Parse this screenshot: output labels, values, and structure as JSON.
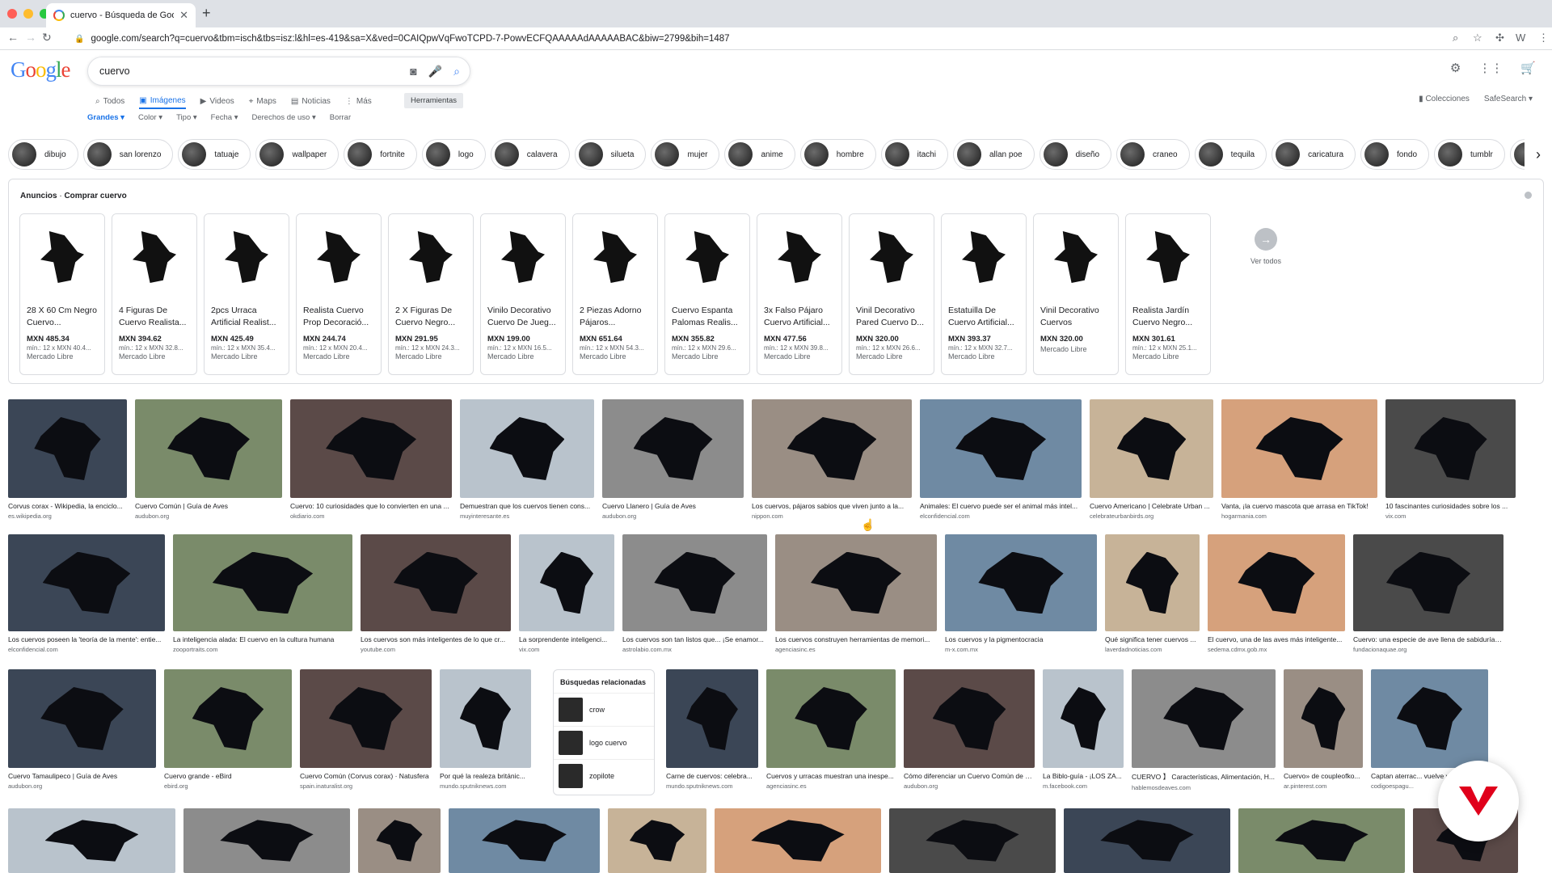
{
  "browser": {
    "tab_title": "cuervo - Búsqueda de Google",
    "url": "google.com/search?q=cuervo&tbm=isch&tbs=isz:l&hl=es-419&sa=X&ved=0CAIQpwVqFwoTCPD-7-PowvECFQAAAAAdAAAAABAC&biw=2799&bih=1487"
  },
  "search": {
    "query": "cuervo"
  },
  "nav_tabs": [
    "Todos",
    "Imágenes",
    "Videos",
    "Maps",
    "Noticias",
    "Más"
  ],
  "tools_label": "Herramientas",
  "right_links": [
    "Colecciones",
    "SafeSearch"
  ],
  "filters": [
    "Grandes",
    "Color",
    "Tipo",
    "Fecha",
    "Derechos de uso",
    "Borrar"
  ],
  "chips": [
    "dibujo",
    "san lorenzo",
    "tatuaje",
    "wallpaper",
    "fortnite",
    "logo",
    "calavera",
    "silueta",
    "mujer",
    "anime",
    "hombre",
    "itachi",
    "allan poe",
    "diseño",
    "craneo",
    "tequila",
    "caricatura",
    "fondo",
    "tumblr",
    "di"
  ],
  "ads": {
    "label": "Anuncios",
    "title": "Comprar cuervo",
    "see_all": "Ver todos",
    "cards": [
      {
        "title": "28 X 60 Cm Negro Cuervo...",
        "price": "MXN 485.34",
        "sub": "mín.: 12 x MXN 40.4...",
        "store": "Mercado Libre"
      },
      {
        "title": "4 Figuras De Cuervo Realista...",
        "price": "MXN 394.62",
        "sub": "mín.: 12 x MXN 32.8...",
        "store": "Mercado Libre"
      },
      {
        "title": "2pcs Urraca Artificial Realist...",
        "price": "MXN 425.49",
        "sub": "mín.: 12 x MXN 35.4...",
        "store": "Mercado Libre"
      },
      {
        "title": "Realista Cuervo Prop Decoració...",
        "price": "MXN 244.74",
        "sub": "mín.: 12 x MXN 20.4...",
        "store": "Mercado Libre"
      },
      {
        "title": "2 X Figuras De Cuervo Negro...",
        "price": "MXN 291.95",
        "sub": "mín.: 12 x MXN 24.3...",
        "store": "Mercado Libre"
      },
      {
        "title": "Vinilo Decorativo Cuervo De Jueg...",
        "price": "MXN 199.00",
        "sub": "mín.: 12 x MXN 16.5...",
        "store": "Mercado Libre"
      },
      {
        "title": "2 Piezas Adorno Pájaros...",
        "price": "MXN 651.64",
        "sub": "mín.: 12 x MXN 54.3...",
        "store": "Mercado Libre"
      },
      {
        "title": "Cuervo Espanta Palomas Realis...",
        "price": "MXN 355.82",
        "sub": "mín.: 12 x MXN 29.6...",
        "store": "Mercado Libre"
      },
      {
        "title": "3x Falso Pájaro Cuervo Artificial...",
        "price": "MXN 477.56",
        "sub": "mín.: 12 x MXN 39.8...",
        "store": "Mercado Libre"
      },
      {
        "title": "Vinil Decorativo Pared Cuervo D...",
        "price": "MXN 320.00",
        "sub": "mín.: 12 x MXN 26.6...",
        "store": "Mercado Libre"
      },
      {
        "title": "Estatuilla De Cuervo Artificial...",
        "price": "MXN 393.37",
        "sub": "mín.: 12 x MXN 32.7...",
        "store": "Mercado Libre"
      },
      {
        "title": "Vinil Decorativo Cuervos",
        "price": "MXN 320.00",
        "sub": "",
        "store": "Mercado Libre"
      },
      {
        "title": "Realista Jardín Cuervo Negro...",
        "price": "MXN 301.61",
        "sub": "mín.: 12 x MXN 25.1...",
        "store": "Mercado Libre"
      }
    ]
  },
  "results_row1": [
    {
      "title": "Corvus corax - Wikipedia, la enciclo...",
      "source": "es.wikipedia.org"
    },
    {
      "title": "Cuervo Común | Guía de Aves",
      "source": "audubon.org"
    },
    {
      "title": "Cuervo: 10 curiosidades que lo convierten en una ...",
      "source": "okdiario.com"
    },
    {
      "title": "Demuestran que los cuervos tienen cons...",
      "source": "muyinteresante.es"
    },
    {
      "title": "Cuervo Llanero | Guía de Aves",
      "source": "audubon.org"
    },
    {
      "title": "Los cuervos, pájaros sabios que viven junto a la...",
      "source": "nippon.com"
    },
    {
      "title": "Animales: El cuervo puede ser el animal más intel...",
      "source": "elconfidencial.com"
    },
    {
      "title": "Cuervo Americano | Celebrate Urban ...",
      "source": "celebrateurbanbirds.org"
    },
    {
      "title": "Vanta, ¡la cuervo mascota que arrasa en TikTok!",
      "source": "hogarmania.com"
    },
    {
      "title": "10 fascinantes curiosidades sobre los ...",
      "source": "vix.com"
    }
  ],
  "results_row2": [
    {
      "title": "Los cuervos poseen la 'teoría de la mente': entie...",
      "source": "elconfidencial.com"
    },
    {
      "title": "La inteligencia alada: El cuervo en la cultura humana",
      "source": "zooportraits.com"
    },
    {
      "title": "Los cuervos son más inteligentes de lo que cr...",
      "source": "youtube.com"
    },
    {
      "title": "La sorprendente inteligenci...",
      "source": "vix.com"
    },
    {
      "title": "Los cuervos son tan listos que... ¡Se enamor...",
      "source": "astrolabio.com.mx"
    },
    {
      "title": "Los cuervos construyen herramientas de memori...",
      "source": "agenciasinc.es"
    },
    {
      "title": "Los cuervos y la pigmentocracia",
      "source": "m-x.com.mx"
    },
    {
      "title": "Qué significa tener cuervos ...",
      "source": "laverdadnoticias.com"
    },
    {
      "title": "El cuervo, una de las aves más inteligente...",
      "source": "sedema.cdmx.gob.mx"
    },
    {
      "title": "Cuervo: una especie de ave llena de sabiduría | F...",
      "source": "fundacionaquae.org"
    }
  ],
  "results_row3a": [
    {
      "title": "Cuervo Tamaulipeco | Guía de Aves",
      "source": "audubon.org"
    },
    {
      "title": "Cuervo grande - eBird",
      "source": "ebird.org"
    },
    {
      "title": "Cuervo Común (Corvus corax) · Natusfera",
      "source": "spain.inaturalist.org"
    },
    {
      "title": "Por qué la realeza británic...",
      "source": "mundo.sputniknews.com"
    }
  ],
  "results_row3b": [
    {
      "title": "Carne de cuervos: celebra...",
      "source": "mundo.sputniknews.com"
    },
    {
      "title": "Cuervos y urracas muestran una inespe...",
      "source": "agenciasinc.es"
    },
    {
      "title": "Cómo diferenciar un Cuervo Común de un...",
      "source": "audubon.org"
    },
    {
      "title": "La Biblo-guía - ¡LOS ZA...",
      "source": "m.facebook.com"
    },
    {
      "title": "CUERVO 】 Características, Alimentación, H...",
      "source": "hablemosdeaves.com"
    },
    {
      "title": "Cuervo» de coupleofko...",
      "source": "ar.pinterest.com"
    },
    {
      "title": "Captan aterrac... vuelve vi...",
      "source": "codigoespagu..."
    }
  ],
  "related": {
    "title": "Búsquedas relacionadas",
    "items": [
      "crow",
      "logo cuervo",
      "zopilote"
    ]
  }
}
